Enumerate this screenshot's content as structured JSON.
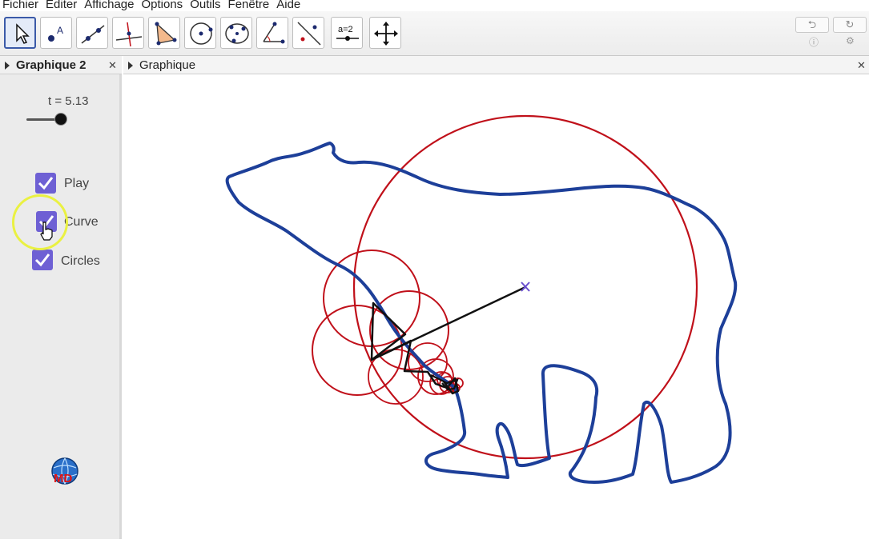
{
  "menu": [
    "Fichier",
    "Editer",
    "Affichage",
    "Options",
    "Outils",
    "Fenêtre",
    "Aide"
  ],
  "toolbar": {
    "tools": [
      {
        "name": "move-tool-icon"
      },
      {
        "name": "point-tool-icon",
        "glyph": "A"
      },
      {
        "name": "line-tool-icon"
      },
      {
        "name": "perpendicular-tool-icon"
      },
      {
        "name": "polygon-tool-icon"
      },
      {
        "name": "circle-tool-icon"
      },
      {
        "name": "conic-tool-icon"
      },
      {
        "name": "angle-tool-icon"
      },
      {
        "name": "reflect-tool-icon"
      },
      {
        "name": "slider-tool-icon",
        "glyph": "a=2"
      },
      {
        "name": "move-view-tool-icon"
      }
    ],
    "undo_icon": "undo-icon",
    "redo_icon": "redo-icon"
  },
  "left_panel": {
    "title": "Graphique 2",
    "slider_label": "t = 5.13",
    "checkboxes": [
      {
        "label": "Play",
        "checked": true
      },
      {
        "label": "Curve",
        "checked": true
      },
      {
        "label": "Circles",
        "checked": true
      }
    ],
    "logo": "md-globe-logo"
  },
  "graphics_view": {
    "title": "Graphique",
    "curve_color": "#1d3f99",
    "circle_color": "#c0101a",
    "vector_color": "#111111",
    "center_marker_color": "#6a4fcf"
  },
  "colors": {
    "checkbox": "#6e60d4",
    "highlight": "#eaf142"
  }
}
